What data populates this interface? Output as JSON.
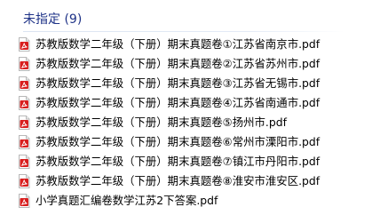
{
  "group": {
    "title": "未指定 (9)"
  },
  "files": [
    {
      "name": "苏教版数学二年级（下册）期末真题卷①江苏省南京市.pdf",
      "icon": "pdf-file-icon"
    },
    {
      "name": "苏教版数学二年级（下册）期末真题卷②江苏省苏州市.pdf",
      "icon": "pdf-file-icon"
    },
    {
      "name": "苏教版数学二年级（下册）期末真题卷③江苏省无锡市.pdf",
      "icon": "pdf-file-icon"
    },
    {
      "name": "苏教版数学二年级（下册）期末真题卷④江苏省南通市.pdf",
      "icon": "pdf-file-icon"
    },
    {
      "name": "苏教版数学二年级（下册）期末真题卷⑤扬州市.pdf",
      "icon": "pdf-file-icon"
    },
    {
      "name": "苏教版数学二年级（下册）期末真题卷⑥常州市溧阳市.pdf",
      "icon": "pdf-file-icon"
    },
    {
      "name": "苏教版数学二年级（下册）期末真题卷⑦镇江市丹阳市.pdf",
      "icon": "pdf-file-icon"
    },
    {
      "name": "苏教版数学二年级（下册）期末真题卷⑧淮安市淮安区.pdf",
      "icon": "pdf-file-icon"
    },
    {
      "name": "小学真题汇编卷数学江苏2下答案.pdf",
      "icon": "pdf-file-icon"
    }
  ],
  "colors": {
    "group_title": "#1e3287",
    "pdf_icon_red": "#d81e1e",
    "text": "#000000"
  }
}
